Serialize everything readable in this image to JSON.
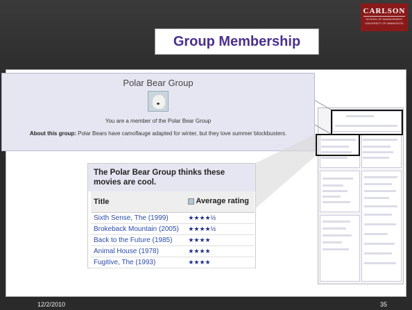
{
  "header": {
    "logo_text": "CARLSON",
    "logo_sub1": "SCHOOL OF MANAGEMENT",
    "logo_sub2": "UNIVERSITY OF MINNESOTA",
    "title": "Group Membership"
  },
  "group": {
    "name": "Polar Bear Group",
    "member_text": "You are a member of the Polar Bear Group",
    "about_label": "About this group:",
    "about_text": "Polar Bears have camoflauge adapted for winter, but they love summer blockbusters."
  },
  "movies": {
    "heading": "The Polar Bear Group thinks these movies are cool.",
    "col_title": "Title",
    "col_rating": "Average rating",
    "rows": [
      {
        "title": "Sixth Sense, The (1999)",
        "stars": "★★★★½"
      },
      {
        "title": "Brokeback Mountain (2005)",
        "stars": "★★★★½"
      },
      {
        "title": "Back to the Future (1985)",
        "stars": "★★★★"
      },
      {
        "title": "Animal House (1978)",
        "stars": "★★★★"
      },
      {
        "title": "Fugitive, The (1993)",
        "stars": "★★★★"
      }
    ]
  },
  "footer": {
    "date": "12/2/2010",
    "page": "35"
  }
}
